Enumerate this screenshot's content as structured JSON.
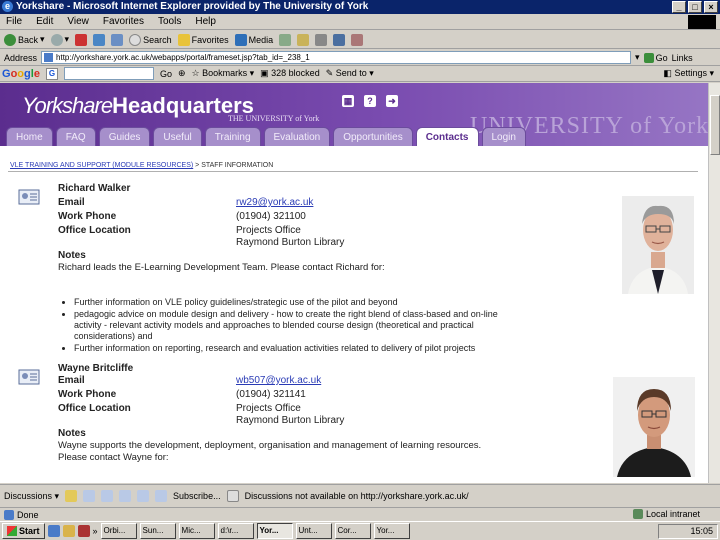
{
  "window": {
    "title": "Yorkshare - Microsoft Internet Explorer provided by The University of York"
  },
  "menubar": [
    "File",
    "Edit",
    "View",
    "Favorites",
    "Tools",
    "Help"
  ],
  "toolbar": {
    "back": "Back",
    "search": "Search",
    "favorites": "Favorites",
    "media": "Media"
  },
  "address": {
    "label": "Address",
    "url": "http://yorkshare.york.ac.uk/webapps/portal/frameset.jsp?tab_id=_238_1",
    "go": "Go",
    "links": "Links"
  },
  "googlebar": {
    "logo": [
      "G",
      "o",
      "o",
      "g",
      "l",
      "e"
    ],
    "go": "Go",
    "bookmarks": "Bookmarks",
    "blocked": "328 blocked",
    "sendto": "Send to",
    "settings": "Settings"
  },
  "banner": {
    "brand_prefix": "Yorkshare",
    "brand_bold": "Headquarters",
    "sub": "THE UNIVERSITY of York",
    "wordmark": "UNIVERSITY of York"
  },
  "tabs": [
    "Home",
    "FAQ",
    "Guides",
    "Useful",
    "Training",
    "Evaluation",
    "Opportunities",
    "Contacts",
    "Login"
  ],
  "active_tab": 7,
  "breadcrumb": {
    "link": "VLE TRAINING AND SUPPORT (MODULE RESOURCES)",
    "current": "STAFF INFORMATION"
  },
  "staff": [
    {
      "name": "Richard Walker",
      "email_label": "Email",
      "email": "rw29@york.ac.uk",
      "phone_label": "Work Phone",
      "phone": "(01904) 321100",
      "office_label": "Office Location",
      "office_line1": "Projects Office",
      "office_line2": "Raymond Burton Library",
      "notes_label": "Notes",
      "notes": "Richard leads the E-Learning Development Team. Please contact Richard for:",
      "bullets": [
        "Further information on VLE policy guidelines/strategic use of the pilot and beyond",
        "pedagogic advice on module design and delivery - how to create the right blend of class-based and on-line activity - relevant activity models and approaches to blended course design (theoretical and practical considerations) and",
        "Further information on reporting, research and evaluation activities related to delivery of pilot projects"
      ]
    },
    {
      "name": "Wayne Britcliffe",
      "email_label": "Email",
      "email": "wb507@york.ac.uk",
      "phone_label": "Work Phone",
      "phone": "(01904) 321141",
      "office_label": "Office Location",
      "office_line1": "Projects Office",
      "office_line2": "Raymond Burton Library",
      "notes_label": "Notes",
      "notes": "Wayne supports the development, deployment, organisation and management of learning resources. Please contact Wayne for:"
    }
  ],
  "discussbar": {
    "discussions": "Discussions",
    "subscribe": "Subscribe...",
    "status": "Discussions not available on http://yorkshare.york.ac.uk/"
  },
  "statusbar": {
    "text": "Done",
    "zone": "Local intranet"
  },
  "taskbar": {
    "start": "Start",
    "tasks": [
      "Orbi...",
      "Sun...",
      "Mic...",
      "d:\\r...",
      "Yor...",
      "Unt...",
      "Cor...",
      "Yor..."
    ],
    "active_index": 4,
    "clock": "15:05"
  }
}
